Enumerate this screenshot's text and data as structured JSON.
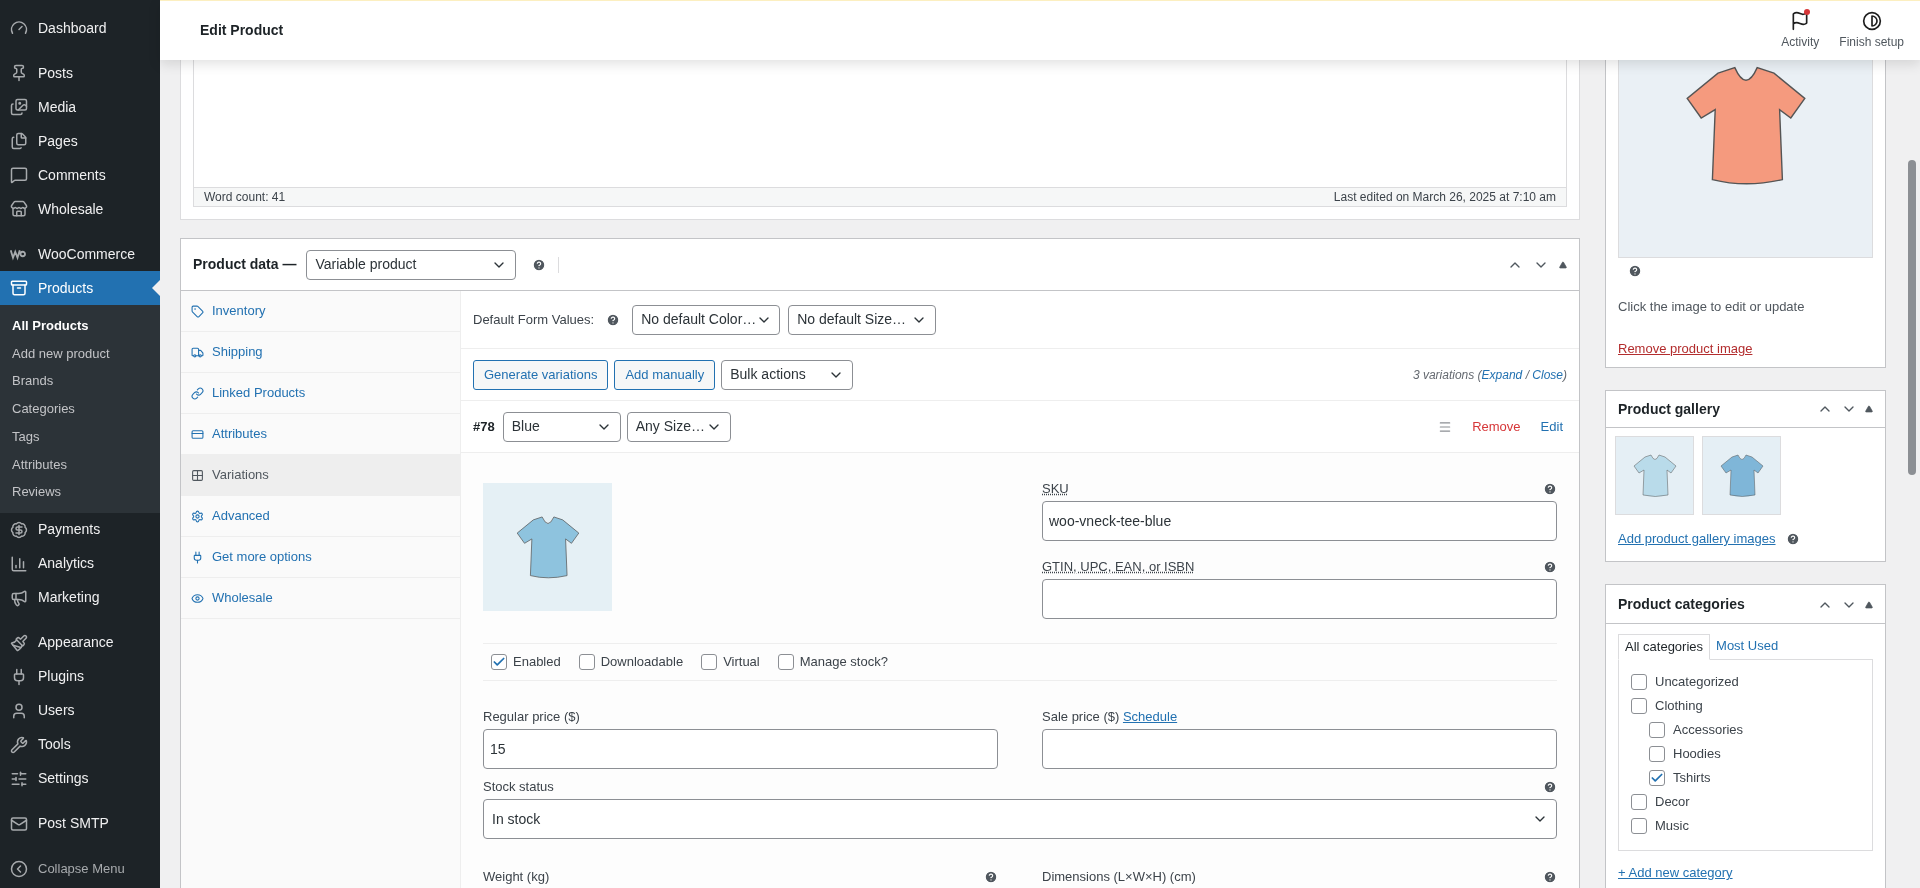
{
  "sidebar": {
    "menu_groups": [
      [
        {
          "label": "Dashboard",
          "selected": false
        }
      ],
      [
        {
          "label": "Posts",
          "selected": false
        },
        {
          "label": "Media",
          "selected": false
        },
        {
          "label": "Pages",
          "selected": false
        },
        {
          "label": "Comments",
          "selected": false
        },
        {
          "label": "Wholesale",
          "selected": false
        }
      ],
      [
        {
          "label": "WooCommerce",
          "selected": false
        },
        {
          "label": "Products",
          "selected": true,
          "submenu": [
            {
              "label": "All Products",
              "selected": true
            },
            {
              "label": "Add new product",
              "selected": false
            },
            {
              "label": "Brands",
              "selected": false
            },
            {
              "label": "Categories",
              "selected": false
            },
            {
              "label": "Tags",
              "selected": false
            },
            {
              "label": "Attributes",
              "selected": false
            },
            {
              "label": "Reviews",
              "selected": false
            }
          ]
        },
        {
          "label": "Payments",
          "selected": false
        },
        {
          "label": "Analytics",
          "selected": false
        },
        {
          "label": "Marketing",
          "selected": false
        }
      ],
      [
        {
          "label": "Appearance",
          "selected": false
        },
        {
          "label": "Plugins",
          "selected": false
        },
        {
          "label": "Users",
          "selected": false
        },
        {
          "label": "Tools",
          "selected": false
        },
        {
          "label": "Settings",
          "selected": false
        }
      ],
      [
        {
          "label": "Post SMTP",
          "selected": false
        }
      ]
    ],
    "collapse": "Collapse Menu"
  },
  "header": {
    "title": "Edit Product",
    "actions": [
      {
        "label": "Activity",
        "notification": true
      },
      {
        "label": "Finish setup",
        "notification": false
      }
    ]
  },
  "editor": {
    "word_count": "Word count: 41",
    "last_edited": "Last edited on March 26, 2025 at 7:10 am"
  },
  "product_data": {
    "label": "Product data —",
    "type_select": "Variable product",
    "tabs": [
      {
        "label": "Inventory",
        "selected": false
      },
      {
        "label": "Shipping",
        "selected": false
      },
      {
        "label": "Linked Products",
        "selected": false
      },
      {
        "label": "Attributes",
        "selected": false
      },
      {
        "label": "Variations",
        "selected": true
      },
      {
        "label": "Advanced",
        "selected": false
      },
      {
        "label": "Get more options",
        "selected": false
      },
      {
        "label": "Wholesale",
        "selected": false
      }
    ],
    "default_form": {
      "label": "Default Form Values:",
      "selects": [
        "No default Color…",
        "No default Size…"
      ]
    },
    "buttons": [
      "Generate variations",
      "Add manually"
    ],
    "bulk_select": "Bulk actions",
    "summary": {
      "prefix": "3 variations (",
      "links": [
        "Expand",
        "Close"
      ],
      "separator": " / ",
      "suffix": ")"
    },
    "variation": {
      "id": "#78",
      "selects": [
        "Blue",
        "Any Size…"
      ],
      "remove": "Remove",
      "edit": "Edit",
      "sku": {
        "label": "SKU",
        "value": "woo-vneck-tee-blue"
      },
      "gtin": {
        "label": "GTIN, UPC, EAN, or ISBN"
      },
      "options": [
        {
          "label": "Enabled",
          "checked": true
        },
        {
          "label": "Downloadable",
          "checked": false
        },
        {
          "label": "Virtual",
          "checked": false
        },
        {
          "label": "Manage stock?",
          "checked": false
        }
      ],
      "regular_price": {
        "label": "Regular price ($)",
        "value": "15"
      },
      "sale_price": {
        "label": "Sale price ($)",
        "link": "Schedule"
      },
      "stock_status": {
        "label": "Stock status",
        "value": "In stock"
      },
      "weight_label": "Weight (kg)",
      "dimensions_label": "Dimensions (L×W×H) (cm)"
    }
  },
  "featured_image": {
    "hint": "Click the image to edit or update",
    "remove": "Remove product image"
  },
  "gallery": {
    "title": "Product gallery",
    "add": "Add product gallery images"
  },
  "categories": {
    "title": "Product categories",
    "tabs": [
      {
        "label": "All categories",
        "selected": true
      },
      {
        "label": "Most Used",
        "selected": false
      }
    ],
    "items": [
      {
        "label": "Uncategorized",
        "checked": false
      },
      {
        "label": "Clothing",
        "checked": false,
        "children": [
          {
            "label": "Accessories",
            "checked": false
          },
          {
            "label": "Hoodies",
            "checked": false
          },
          {
            "label": "Tshirts",
            "checked": true
          }
        ]
      },
      {
        "label": "Decor",
        "checked": false
      },
      {
        "label": "Music",
        "checked": false
      }
    ],
    "add": "+ Add new category"
  }
}
